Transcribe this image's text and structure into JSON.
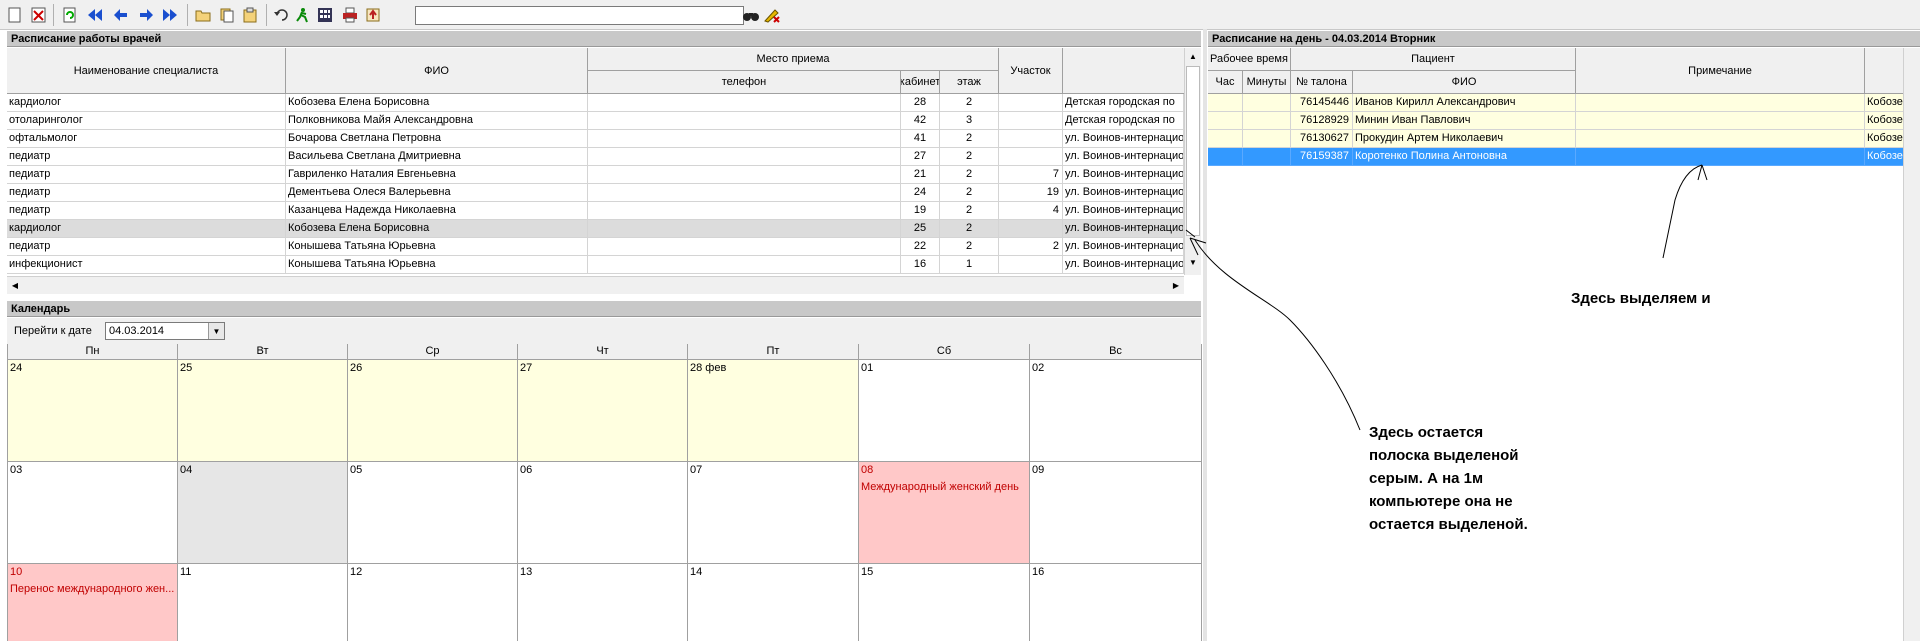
{
  "toolbar": {
    "buttons": [
      "new-icon",
      "delete-icon",
      "refresh-icon",
      "first-icon",
      "prev-icon",
      "next-icon",
      "last-icon",
      "open-icon",
      "copy-icon",
      "paste-icon",
      "undo-icon",
      "run-icon",
      "calculator-icon",
      "print-icon",
      "export-icon"
    ],
    "search_value": ""
  },
  "left_panel": {
    "title": "Расписание работы врачей",
    "headers": {
      "spec": "Наименование специалиста",
      "fio": "ФИО",
      "place": "Место приема",
      "phone": "телефон",
      "cab": "кабинет",
      "floor": "этаж",
      "area": "Участок"
    },
    "rows": [
      {
        "spec": "кардиолог",
        "fio": "Кобозева Елена Борисовна",
        "phone": "",
        "cab": "28",
        "floor": "2",
        "area": "",
        "addr": "Детская городская по"
      },
      {
        "spec": "отоларинголог",
        "fio": "Полковникова Майя Александровна",
        "phone": "",
        "cab": "42",
        "floor": "3",
        "area": "",
        "addr": "Детская городская по"
      },
      {
        "spec": "офтальмолог",
        "fio": "Бочарова Светлана Петровна",
        "phone": "",
        "cab": "41",
        "floor": "2",
        "area": "",
        "addr": "ул. Воинов-интернацио"
      },
      {
        "spec": "педиатр",
        "fio": "Васильева Светлана Дмитриевна",
        "phone": "",
        "cab": "27",
        "floor": "2",
        "area": "",
        "addr": "ул. Воинов-интернацио"
      },
      {
        "spec": "педиатр",
        "fio": "Гавриленко Наталия Евгеньевна",
        "phone": "",
        "cab": "21",
        "floor": "2",
        "area": "7",
        "addr": "ул. Воинов-интернацио"
      },
      {
        "spec": "педиатр",
        "fio": "Дементьева Олеся Валерьевна",
        "phone": "",
        "cab": "24",
        "floor": "2",
        "area": "19",
        "addr": "ул. Воинов-интернацио"
      },
      {
        "spec": "педиатр",
        "fio": "Казанцева Надежда Николаевна",
        "phone": "",
        "cab": "19",
        "floor": "2",
        "area": "4",
        "addr": "ул. Воинов-интернацио"
      },
      {
        "spec": "кардиолог",
        "fio": "Кобозева Елена Борисовна",
        "phone": "",
        "cab": "25",
        "floor": "2",
        "area": "",
        "addr": "ул. Воинов-интернацио"
      },
      {
        "spec": "педиатр",
        "fio": "Конышева Татьяна Юрьевна",
        "phone": "",
        "cab": "22",
        "floor": "2",
        "area": "2",
        "addr": "ул. Воинов-интернацио"
      },
      {
        "spec": "инфекционист",
        "fio": "Конышева Татьяна Юрьевна",
        "phone": "",
        "cab": "16",
        "floor": "1",
        "area": "",
        "addr": "ул. Воинов-интернацио"
      }
    ],
    "highlight_color": "#dcdcdc"
  },
  "calendar": {
    "title": "Календарь",
    "goto_label": "Перейти к дате",
    "goto_value": "04.03.2014",
    "weekdays": [
      "Пн",
      "Вт",
      "Ср",
      "Чт",
      "Пт",
      "Сб",
      "Вс"
    ],
    "weeks": [
      [
        {
          "d": "24",
          "bg": "#ffffe0"
        },
        {
          "d": "25",
          "bg": "#ffffe0"
        },
        {
          "d": "26",
          "bg": "#ffffe0"
        },
        {
          "d": "27",
          "bg": "#ffffe0"
        },
        {
          "d": "28 фев",
          "bg": "#ffffe0"
        },
        {
          "d": "01",
          "bg": "#ffffff"
        },
        {
          "d": "02",
          "bg": "#ffffff"
        }
      ],
      [
        {
          "d": "03",
          "bg": "#ffffff"
        },
        {
          "d": "04",
          "bg": "#e6e6e6"
        },
        {
          "d": "05",
          "bg": "#ffffff"
        },
        {
          "d": "06",
          "bg": "#ffffff"
        },
        {
          "d": "07",
          "bg": "#ffffff"
        },
        {
          "d": "08",
          "bg": "#ffc8c8",
          "note": "Международный женский день",
          "holiday": true
        },
        {
          "d": "09",
          "bg": "#ffffff"
        }
      ],
      [
        {
          "d": "10",
          "bg": "#ffc8c8",
          "note": "Перенос международного жен...",
          "holiday": true
        },
        {
          "d": "11",
          "bg": "#ffffff"
        },
        {
          "d": "12",
          "bg": "#ffffff"
        },
        {
          "d": "13",
          "bg": "#ffffff"
        },
        {
          "d": "14",
          "bg": "#ffffff"
        },
        {
          "d": "15",
          "bg": "#ffffff"
        },
        {
          "d": "16",
          "bg": "#ffffff"
        }
      ]
    ]
  },
  "right_panel": {
    "title": "Расписание на день - 04.03.2014  Вторник",
    "headers": {
      "worktime": "Рабочее время",
      "patient": "Пациент",
      "hour": "Час",
      "minutes": "Минуты",
      "ticket": "№ талона",
      "fio": "ФИО",
      "note": "Примечание"
    },
    "rows": [
      {
        "hour": "",
        "min": "",
        "ticket": "76145446",
        "fio": "Иванов Кирилл Александрович",
        "note": "",
        "doc": "Кобозева"
      },
      {
        "hour": "",
        "min": "",
        "ticket": "76128929",
        "fio": "Минин Иван Павлович",
        "note": "",
        "doc": "Кобозева"
      },
      {
        "hour": "",
        "min": "",
        "ticket": "76130627",
        "fio": "Прокудин Артем Николаевич",
        "note": "",
        "doc": "Кобозева"
      },
      {
        "hour": "",
        "min": "",
        "ticket": "76159387",
        "fio": "Коротенко Полина Антоновна",
        "note": "",
        "doc": "Кобозева"
      }
    ],
    "row_color": "#ffffe0",
    "selected_color": "#3399ff"
  },
  "annotations": {
    "top": "Здесь выделяем и",
    "bottom": [
      "Здесь остается",
      "полоска выделеной",
      "серым. А на 1м",
      "компьютере она не",
      "остается выделеной."
    ]
  }
}
